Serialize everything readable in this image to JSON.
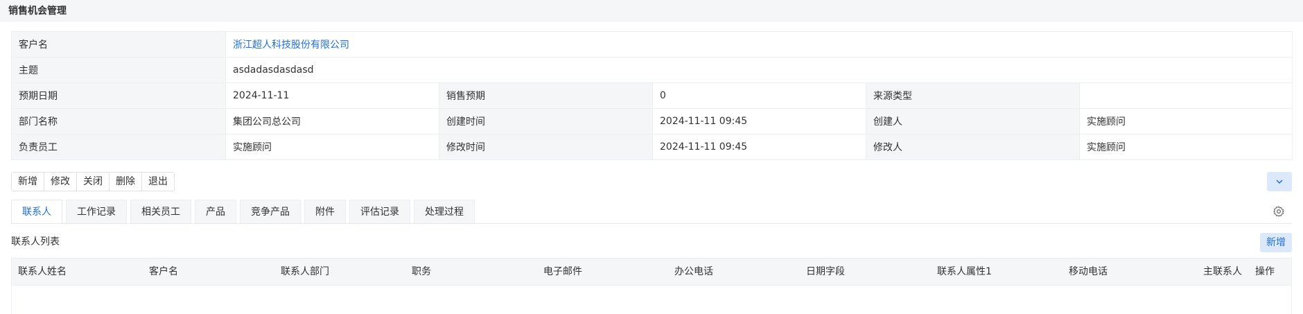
{
  "page": {
    "title": "销售机会管理"
  },
  "info": {
    "customer_label": "客户名",
    "customer_value": "浙江超人科技股份有限公司",
    "subject_label": "主题",
    "subject_value": "asdadasdasdasd",
    "expected_date_label": "预期日期",
    "expected_date_value": "2024-11-11",
    "sales_forecast_label": "销售预期",
    "sales_forecast_value": "0",
    "source_type_label": "来源类型",
    "source_type_value": "",
    "dept_label": "部门名称",
    "dept_value": "集团公司总公司",
    "created_time_label": "创建时间",
    "created_time_value": "2024-11-11 09:45",
    "creator_label": "创建人",
    "creator_value": "实施顾问",
    "owner_label": "负责员工",
    "owner_value": "实施顾问",
    "modified_time_label": "修改时间",
    "modified_time_value": "2024-11-11 09:45",
    "modifier_label": "修改人",
    "modifier_value": "实施顾问"
  },
  "toolbar": {
    "buttons": [
      "新增",
      "修改",
      "关闭",
      "删除",
      "退出"
    ]
  },
  "tabs": [
    "联系人",
    "工作记录",
    "相关员工",
    "产品",
    "竞争产品",
    "附件",
    "评估记录",
    "处理过程"
  ],
  "contacts": {
    "title": "联系人列表",
    "add_label": "新增",
    "columns": [
      "联系人姓名",
      "客户名",
      "联系人部门",
      "职务",
      "电子邮件",
      "办公电话",
      "日期字段",
      "联系人属性1",
      "移动电话",
      "主联系人",
      "操作"
    ]
  },
  "colors": {
    "accent": "#1e6fd9",
    "accent_light": "#dbe9fb",
    "header_bg": "#f5f6f8",
    "border": "#ebeef5"
  }
}
